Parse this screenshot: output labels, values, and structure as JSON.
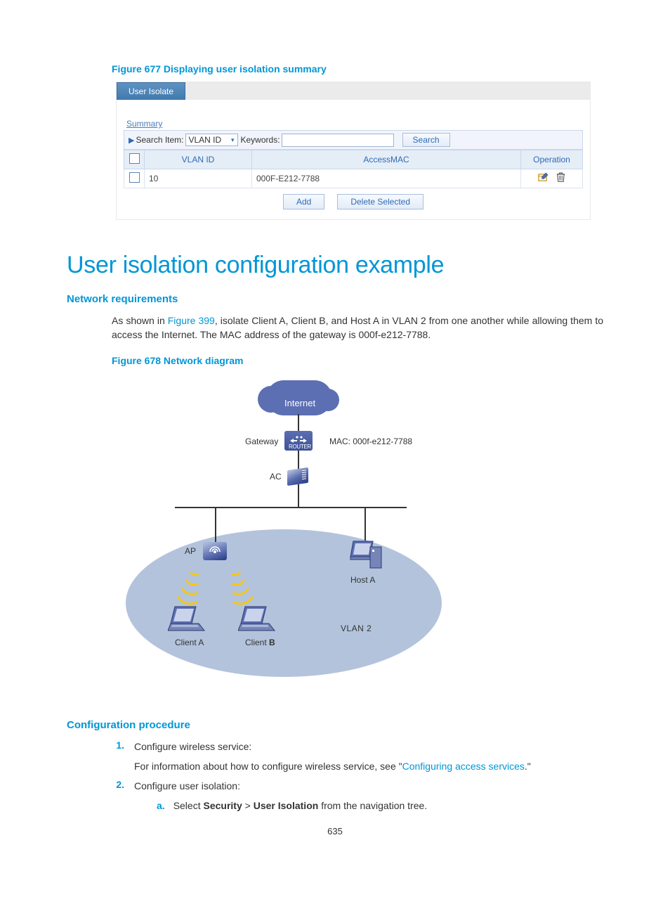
{
  "fig677_caption": "Figure 677 Displaying user isolation summary",
  "ui": {
    "tab_label": "User Isolate",
    "summary_link": "Summary",
    "search_item_label": "Search Item:",
    "search_item_value": "VLAN ID",
    "keywords_label": "Keywords:",
    "keywords_value": "",
    "search_btn": "Search",
    "col_vlan": "VLAN ID",
    "col_mac": "AccessMAC",
    "col_op": "Operation",
    "row_vlan": "10",
    "row_mac": "000F-E212-7788",
    "add_btn": "Add",
    "delete_btn": "Delete Selected"
  },
  "h1": "User isolation configuration example",
  "h2_req": "Network requirements",
  "req_text_a": "As shown in ",
  "req_text_link": "Figure 399",
  "req_text_b": ", isolate Client A, Client B, and Host A in VLAN 2 from one another while allowing them to access the Internet. The MAC address of the gateway is 000f-e212-7788.",
  "fig678_caption": "Figure 678 Network diagram",
  "diagram": {
    "internet": "Internet",
    "gateway": "Gateway",
    "gateway_mac": "MAC: 000f-e212-7788",
    "router_caption": "ROUTER",
    "ac": "AC",
    "ap": "AP",
    "hosta": "Host A",
    "clienta": "Client A",
    "clientb": "Client B",
    "vlan2": "VLAN 2"
  },
  "h2_proc": "Configuration procedure",
  "proc": {
    "n1": "1.",
    "t1": "Configure wireless service:",
    "t1_sub": "For information about how to configure wireless service, see \"",
    "t1_link": "Configuring access services",
    "t1_end": ".\"",
    "n2": "2.",
    "t2": "Configure user isolation:",
    "sa": "a.",
    "sa_text_a": "Select ",
    "sa_text_b": "Security",
    "sa_text_c": " > ",
    "sa_text_d": "User Isolation",
    "sa_text_e": " from the navigation tree."
  },
  "page_num": "635"
}
